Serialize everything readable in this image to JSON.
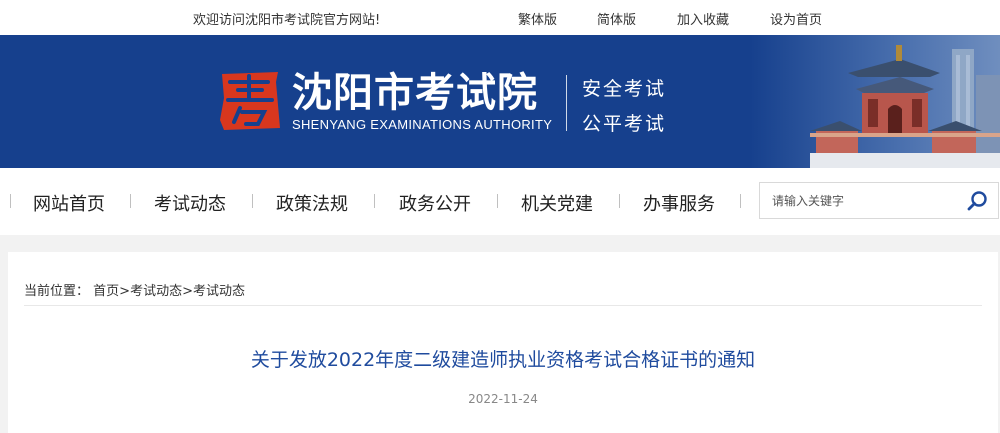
{
  "topbar": {
    "welcome": "欢迎访问沈阳市考试院官方网站!",
    "links": [
      "繁体版",
      "简体版",
      "加入收藏",
      "设为首页"
    ]
  },
  "banner": {
    "logo_char": "考",
    "name_cn": "沈阳市考试院",
    "name_en": "SHENYANG EXAMINATIONS AUTHORITY",
    "slogan1": "安全考试",
    "slogan2": "公平考试",
    "colors": {
      "banner_bg": "#16408d",
      "logo_red": "#d8371e"
    }
  },
  "nav": {
    "items": [
      "网站首页",
      "考试动态",
      "政策法规",
      "政务公开",
      "机关党建",
      "办事服务"
    ]
  },
  "search": {
    "placeholder": "请输入关键字",
    "icon": "search-icon"
  },
  "breadcrumb": {
    "label": "当前位置：",
    "items": [
      "首页",
      "考试动态",
      "考试动态"
    ],
    "separator": ">"
  },
  "article": {
    "title": "关于发放2022年度二级建造师执业资格考试合格证书的通知",
    "date": "2022-11-24"
  }
}
